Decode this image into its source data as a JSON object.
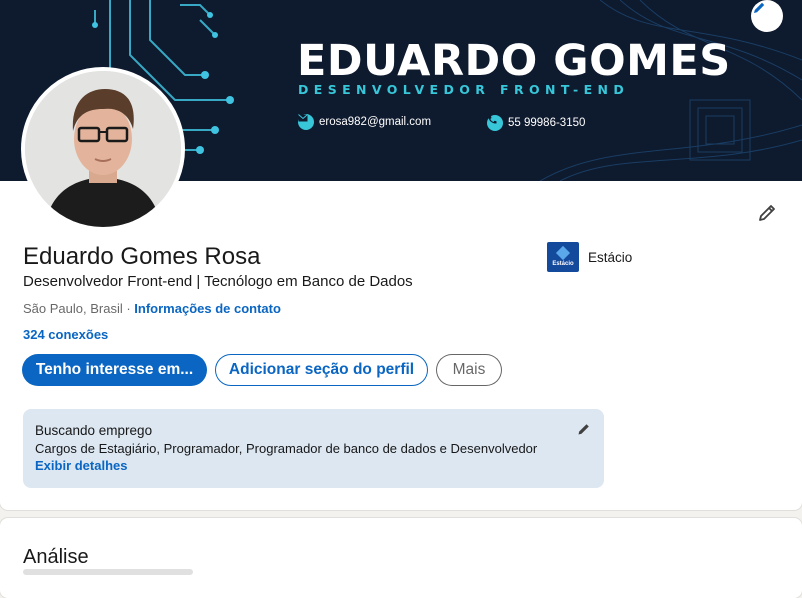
{
  "banner": {
    "name": "EDUARDO GOMES",
    "role": "DESENVOLVEDOR FRONT-END",
    "email": "erosa982@gmail.com",
    "phone": "55 99986-3150",
    "colors": {
      "background": "#0e1a2e",
      "accent": "#38c6d9"
    }
  },
  "profile": {
    "name": "Eduardo Gomes Rosa",
    "headline": "Desenvolvedor Front-end | Tecnólogo em Banco de Dados",
    "location": "São Paulo, Brasil",
    "separator": " · ",
    "contact_link": "Informações de contato",
    "connections": "324 conexões",
    "education": {
      "logo_text": "Estácio",
      "name": "Estácio"
    }
  },
  "actions": {
    "primary": "Tenho interesse em...",
    "secondary": "Adicionar seção do perfil",
    "more": "Mais"
  },
  "open_to_work": {
    "title": "Buscando emprego",
    "description": "Cargos de Estagiário, Programador, Programador de banco de dados e Desenvolvedor",
    "link": "Exibir detalhes"
  },
  "analytics": {
    "title": "Análise"
  },
  "colors": {
    "link": "#0a66c2",
    "open_to_work_bg": "#dde7f1",
    "page_bg": "#f4f2ee"
  }
}
